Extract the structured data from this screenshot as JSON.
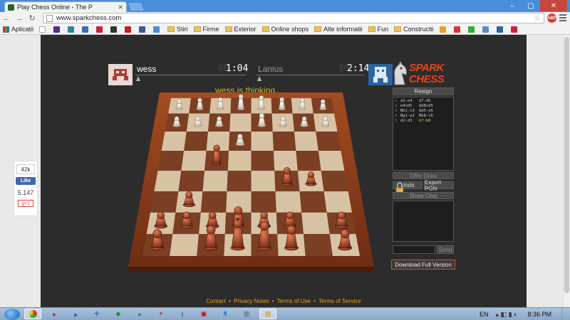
{
  "browser": {
    "tab_title": "Play Chess Online - The P",
    "url": "www.sparkchess.com",
    "abp_badge": "ABP",
    "bookmarks": [
      "Aplicații",
      "Stiri",
      "Firme",
      "Exterior",
      "Online shops",
      "Alte informatii",
      "Fun",
      "Constructii"
    ]
  },
  "social": {
    "like_count": "42k",
    "like_label": "Like",
    "share_count": "5.147",
    "gplus_label": "g+1"
  },
  "game": {
    "player1": {
      "name": "wess",
      "clock": "1:04",
      "clock_ghost": "88"
    },
    "player2": {
      "name": "Lanius",
      "clock": "2:14",
      "clock_ghost": "88"
    },
    "status": "wess is thinking...",
    "logo_line1": "SPARK",
    "logo_line2": "CHESS",
    "resign_label": "Resign",
    "moves": [
      {
        "n": "1",
        "w": "e2-e4",
        "b": "d7-d5"
      },
      {
        "n": "2",
        "w": "e4xd5",
        "b": "Qd8xd5"
      },
      {
        "n": "3",
        "w": "Nb1-c3",
        "b": "Qd5-e5"
      },
      {
        "n": "4",
        "w": "Ng1-e2",
        "b": "Nb8-c6"
      },
      {
        "n": "5",
        "w": "d2-d3",
        "b": "b7-b6"
      }
    ],
    "offer_draw_label": "Offer Draw",
    "undo_label": "Undo",
    "export_label": "Export PGN",
    "score_label": "Show Chat",
    "send_label": "Send",
    "download_label": "Download Full Version"
  },
  "footer": {
    "links": [
      "Contact",
      "Privacy Notes",
      "Terms of Use",
      "Terms of Service"
    ],
    "separator": "•"
  },
  "taskbar": {
    "lang": "EN",
    "time": "8:36 PM"
  },
  "colors": {
    "light_square": "#d7c3a4",
    "dark_square": "#7b3f23",
    "frame": "#8c3f1d",
    "accent_orange": "#e8431f",
    "status_yellow": "#d6b42a"
  }
}
